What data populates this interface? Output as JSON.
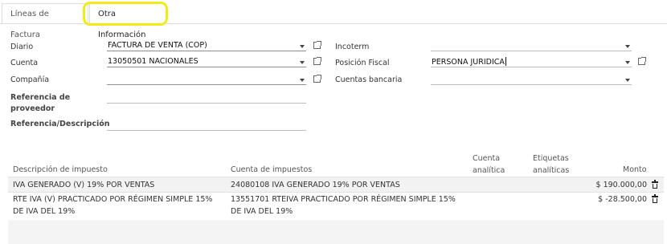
{
  "tabs": [
    {
      "label": "Líneas de Factura"
    },
    {
      "label": "Otra Información"
    }
  ],
  "form": {
    "diario": {
      "label": "Diario",
      "value": "FACTURA DE VENTA (COP)"
    },
    "cuenta": {
      "label": "Cuenta",
      "value": "13050501 NACIONALES"
    },
    "compania": {
      "label": "Compañía",
      "value": ""
    },
    "referencia_proveedor": {
      "label": "Referencia de proveedor",
      "value": ""
    },
    "referencia_descripcion": {
      "label": "Referencia/Descripción",
      "value": ""
    },
    "incoterm": {
      "label": "Incoterm",
      "value": ""
    },
    "posicion_fiscal": {
      "label": "Posición Fiscal",
      "value": "PERSONA JURIDICA"
    },
    "cuentas_bancaria": {
      "label": "Cuentas bancaria",
      "value": ""
    }
  },
  "tax_table": {
    "columns": {
      "descripcion": "Descripción de impuesto",
      "cuenta": "Cuenta de impuestos",
      "cuenta_analitica": "Cuenta analítica",
      "etiquetas_analiticas": "Etiquetas analíticas",
      "monto": "Monto"
    },
    "rows": [
      {
        "descripcion": "IVA GENERADO (V) 19% POR VENTAS",
        "cuenta": "24080108 IVA GENERADO 19% POR VENTAS",
        "cuenta_analitica": "",
        "etiquetas_analiticas": "",
        "monto": "$ 190.000,00"
      },
      {
        "descripcion": "RTE IVA (V) PRACTICADO POR RÉGIMEN SIMPLE 15% DE IVA DEL 19%",
        "cuenta": "13551701 RTEIVA PRACTICADO POR RÉGIMEN SIMPLE 15% DE IVA DEL 19%",
        "cuenta_analitica": "",
        "etiquetas_analiticas": "",
        "monto": "$ -28.500,00"
      }
    ]
  },
  "icons": {
    "dropdown": "chevron-down-icon",
    "external": "external-link-icon",
    "delete": "trash-icon",
    "highlight_color": "#f3ec14"
  }
}
